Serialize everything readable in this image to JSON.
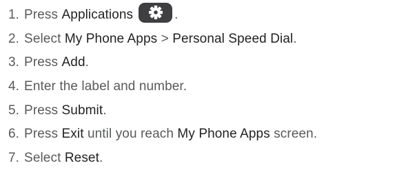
{
  "steps": [
    {
      "num": "1.",
      "t1": "Press ",
      "b1": "Applications",
      "t2": ".",
      "icon": "gear-icon"
    },
    {
      "num": "2.",
      "t1": "Select ",
      "b1": "My Phone Apps",
      "t2": " > ",
      "b2": "Personal Speed Dial",
      "t3": "."
    },
    {
      "num": "3.",
      "t1": "Press ",
      "b1": "Add",
      "t2": "."
    },
    {
      "num": "4.",
      "t1": "Enter the label and number."
    },
    {
      "num": "5.",
      "t1": "Press ",
      "b1": "Submit",
      "t2": "."
    },
    {
      "num": "6.",
      "t1": "Press ",
      "b1": "Exit",
      "t2": " until you reach ",
      "b2": "My Phone Apps",
      "t3": " screen."
    },
    {
      "num": "7.",
      "t1": "Select ",
      "b1": "Reset",
      "t2": "."
    }
  ]
}
